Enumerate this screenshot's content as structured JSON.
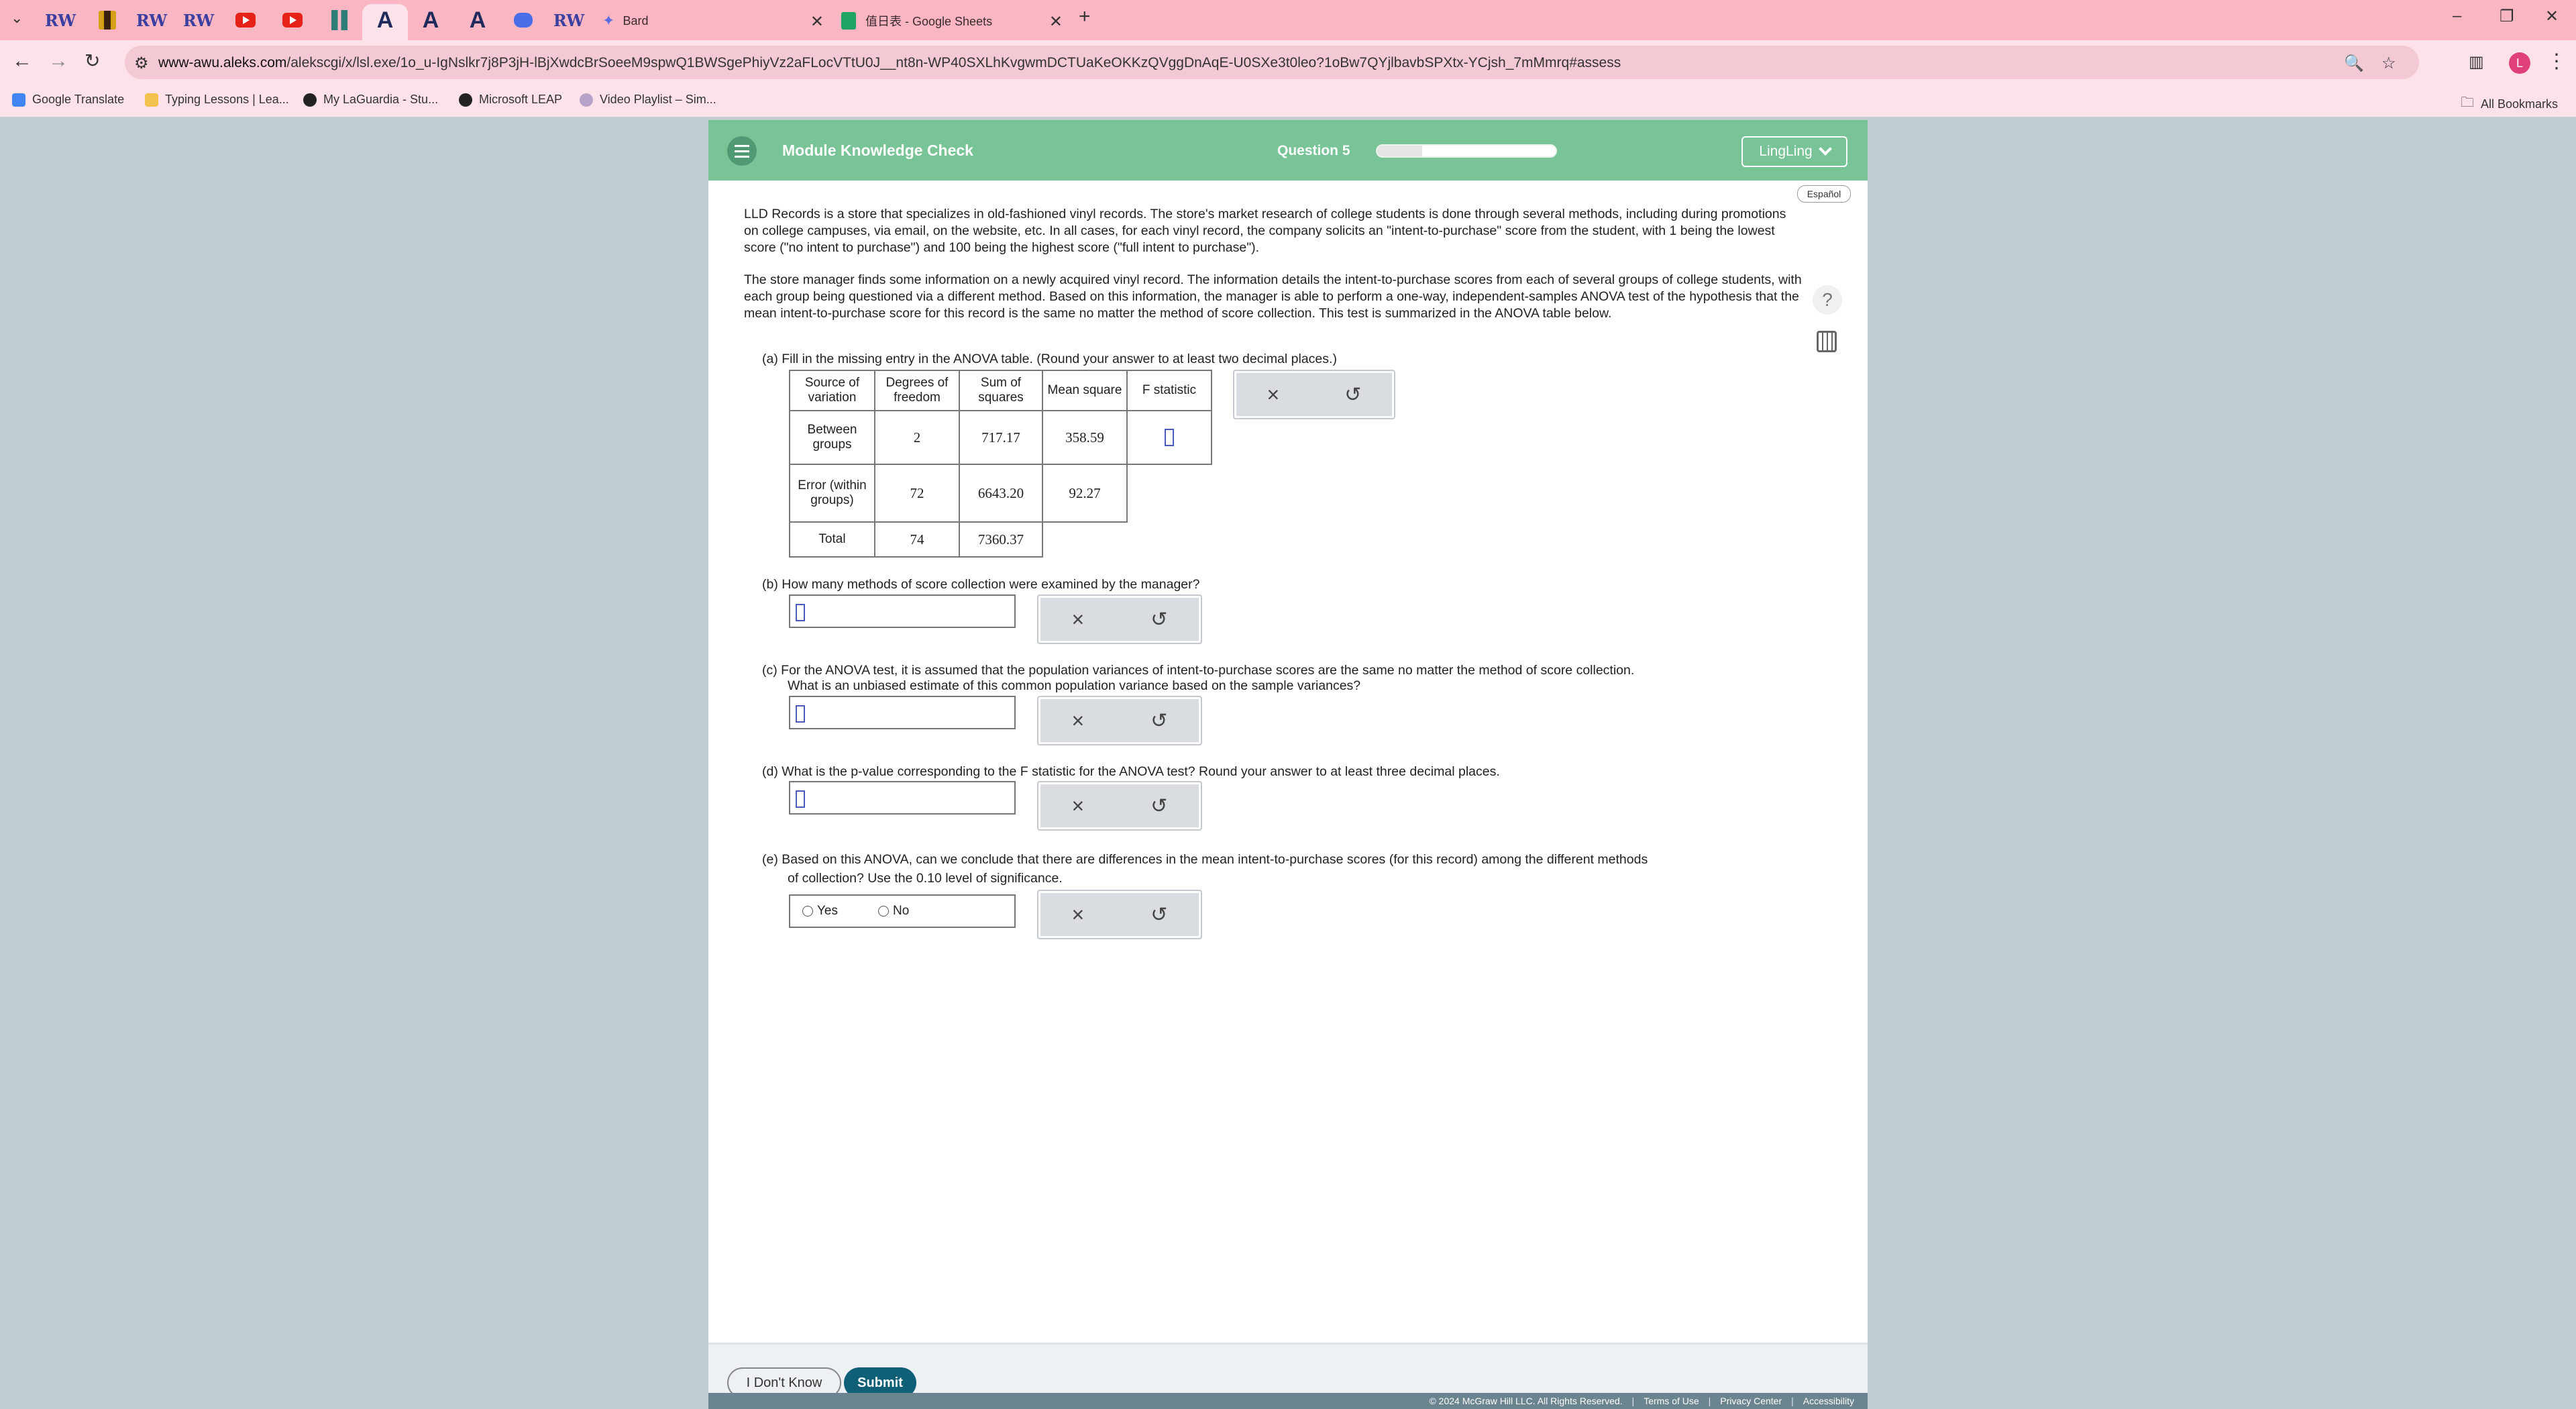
{
  "browser": {
    "tabs": [
      {
        "label": "Bard"
      },
      {
        "label": "值日表 - Google Sheets"
      }
    ],
    "url_host": "www-awu.aleks.com",
    "url_path": "/alekscgi/x/lsl.exe/1o_u-IgNslkr7j8P3jH-lBjXwdcBrSoeeM9spwQ1BWSgePhiyVz2aFLocVTtU0J__nt8n-WP40SXLhKvgwmDCTUaKeOKKzQVggDnAqE-U0SXe3t0leo?1oBw7QYjlbavbSPXtx-YCjsh_7mMmrq#assess",
    "profile_initial": "L",
    "bookmarks": [
      {
        "label": "Google Translate"
      },
      {
        "label": "Typing Lessons | Lea..."
      },
      {
        "label": "My LaGuardia - Stu..."
      },
      {
        "label": "Microsoft LEAP"
      },
      {
        "label": "Video Playlist – Sim..."
      }
    ],
    "all_bookmarks": "All Bookmarks"
  },
  "header": {
    "title": "Module Knowledge Check",
    "question_label": "Question 5",
    "progress_fraction": 0.25,
    "user": "LingLing",
    "language_button": "Español"
  },
  "intro": {
    "p1": "LLD Records is a store that specializes in old-fashioned vinyl records. The store's market research of college students is done through several methods, including during promotions on college campuses, via email, on the website, etc. In all cases, for each vinyl record, the company solicits an \"intent-to-purchase\" score from the student, with 1 being the lowest score (\"no intent to purchase\") and 100 being the highest score (\"full intent to purchase\").",
    "p2": "The store manager finds some information on a newly acquired vinyl record. The information details the intent-to-purchase scores from each of several groups of college students, with each group being questioned via a different method. Based on this information, the manager is able to perform a one-way, independent-samples ANOVA test of the hypothesis that the mean intent-to-purchase score for this record is the same no matter the method of score collection. This test is summarized in the ANOVA table below."
  },
  "part_a": {
    "prompt": "(a) Fill in the missing entry in the ANOVA table. (Round your answer to at least two decimal places.)",
    "table": {
      "headers": [
        "Source of variation",
        "Degrees of freedom",
        "Sum of squares",
        "Mean square",
        "F statistic"
      ],
      "rows": [
        {
          "source": "Between groups",
          "df": "2",
          "ss": "717.17",
          "ms": "358.59"
        },
        {
          "source": "Error (within groups)",
          "df": "72",
          "ss": "6643.20",
          "ms": "92.27"
        },
        {
          "source": "Total",
          "df": "74",
          "ss": "7360.37"
        }
      ]
    }
  },
  "part_b": {
    "prompt": "(b) How many methods of score collection were examined by the manager?"
  },
  "part_c": {
    "prompt1": "(c) For the ANOVA test, it is assumed that the population variances of intent-to-purchase scores are the same no matter the method of score collection.",
    "prompt2": "What is an unbiased estimate of this common population variance based on the sample variances?"
  },
  "part_d": {
    "prompt": "(d) What is the p-value corresponding to the F statistic for the ANOVA test? Round your answer to at least three decimal places."
  },
  "part_e": {
    "prompt1": "(e) Based on this ANOVA, can we conclude that there are differences in the mean intent-to-purchase scores (for this record) among the different methods",
    "prompt2": "of collection? Use the 0.10 level of significance.",
    "options": [
      "Yes",
      "No"
    ]
  },
  "tools": {
    "clear": "×",
    "undo": "↺"
  },
  "footer": {
    "dont_know": "I Don't Know",
    "submit": "Submit",
    "copyright": "© 2024 McGraw Hill LLC. All Rights Reserved.",
    "terms": "Terms of Use",
    "privacy": "Privacy Center",
    "accessibility": "Accessibility"
  }
}
